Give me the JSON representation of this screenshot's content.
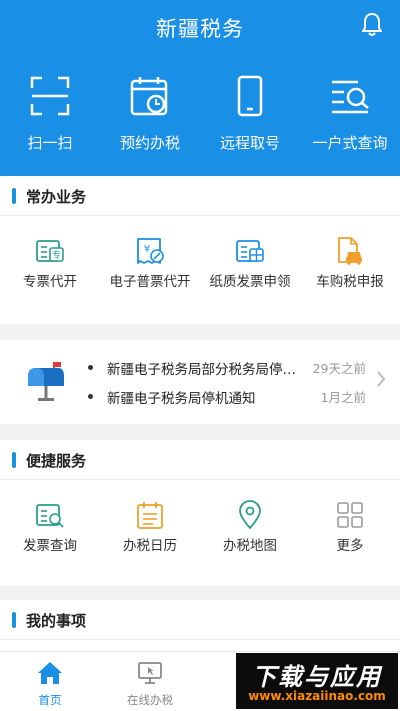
{
  "header": {
    "title": "新疆税务",
    "quick_actions": [
      {
        "label": "扫一扫",
        "icon": "scan-icon"
      },
      {
        "label": "预约办税",
        "icon": "calendar-clock-icon"
      },
      {
        "label": "远程取号",
        "icon": "phone-icon"
      },
      {
        "label": "一户式查询",
        "icon": "search-list-icon"
      }
    ]
  },
  "common": {
    "title": "常办业务",
    "items": [
      {
        "label": "专票代开",
        "icon": "special-invoice-icon"
      },
      {
        "label": "电子普票代开",
        "icon": "e-invoice-icon"
      },
      {
        "label": "纸质发票申领",
        "icon": "paper-invoice-icon"
      },
      {
        "label": "车购税申报",
        "icon": "vehicle-tax-icon"
      }
    ]
  },
  "notices": [
    {
      "title": "新疆电子税务局部分税务局停机通知",
      "date": "29天之前"
    },
    {
      "title": "新疆电子税务局停机通知",
      "date": "1月之前"
    }
  ],
  "convenient": {
    "title": "便捷服务",
    "items": [
      {
        "label": "发票查询",
        "icon": "invoice-query-icon"
      },
      {
        "label": "办税日历",
        "icon": "tax-calendar-icon"
      },
      {
        "label": "办税地图",
        "icon": "map-pin-icon"
      },
      {
        "label": "更多",
        "icon": "grid-more-icon"
      }
    ]
  },
  "my_items": {
    "title": "我的事项"
  },
  "tabbar": {
    "tabs": [
      {
        "label": "首页",
        "icon": "home-icon",
        "active": true
      },
      {
        "label": "在线办税",
        "icon": "monitor-icon",
        "active": false
      },
      {
        "label": "",
        "icon": "tab-icon",
        "active": false
      },
      {
        "label": "",
        "icon": "tab-icon",
        "active": false
      }
    ]
  },
  "watermark": {
    "line1": "下载与应用",
    "line2": "www.xiazaiinao.com"
  },
  "colors": {
    "primary": "#1a8fe6",
    "teal": "#2a9d8f",
    "orange": "#f0a02a",
    "gray_icon": "#9a9a9a"
  }
}
